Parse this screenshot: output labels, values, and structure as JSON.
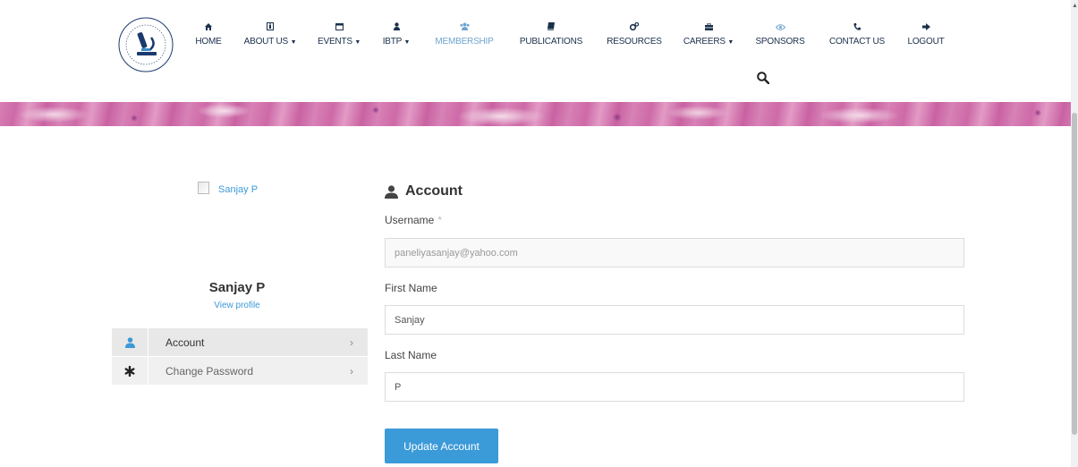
{
  "nav": [
    {
      "label": "HOME",
      "icon": "home-icon",
      "caret": ""
    },
    {
      "label": "ABOUT US",
      "icon": "info-icon",
      "caret": "▼"
    },
    {
      "label": "EVENTS",
      "icon": "calendar-icon",
      "caret": "▼"
    },
    {
      "label": "IBTP",
      "icon": "user-icon",
      "caret": "▼"
    },
    {
      "label": "MEMBERSHIP",
      "icon": "users-icon",
      "caret": "",
      "active": true
    },
    {
      "label": "PUBLICATIONS",
      "icon": "book-icon",
      "caret": ""
    },
    {
      "label": "RESOURCES",
      "icon": "gears-icon",
      "caret": ""
    },
    {
      "label": "CAREERS",
      "icon": "briefcase-icon",
      "caret": "▼"
    },
    {
      "label": "SPONSORS",
      "icon": "eye-icon",
      "caret": ""
    },
    {
      "label": "CONTACT US",
      "icon": "phone-icon",
      "caret": ""
    },
    {
      "label": "LOGOUT",
      "icon": "sign-out-icon",
      "caret": ""
    }
  ],
  "colors": {
    "accent": "#3b9ad8",
    "nav_text": "#1a2f4b",
    "nav_active": "#6fa5cf"
  },
  "profile": {
    "avatar_alt": "Sanjay P",
    "name": "Sanjay P",
    "view_profile": "View profile"
  },
  "sidebar": [
    {
      "label": "Account",
      "icon": "user-icon",
      "chevron": "›",
      "active": true
    },
    {
      "label": "Change Password",
      "icon": "asterisk-icon",
      "chevron": "›",
      "active": false
    }
  ],
  "form": {
    "title": "Account",
    "username_label": "Username",
    "username_required": "*",
    "username_value": "paneliyasanjay@yahoo.com",
    "first_name_label": "First Name",
    "first_name_value": "Sanjay",
    "last_name_label": "Last Name",
    "last_name_value": "P",
    "submit_label": "Update Account"
  }
}
